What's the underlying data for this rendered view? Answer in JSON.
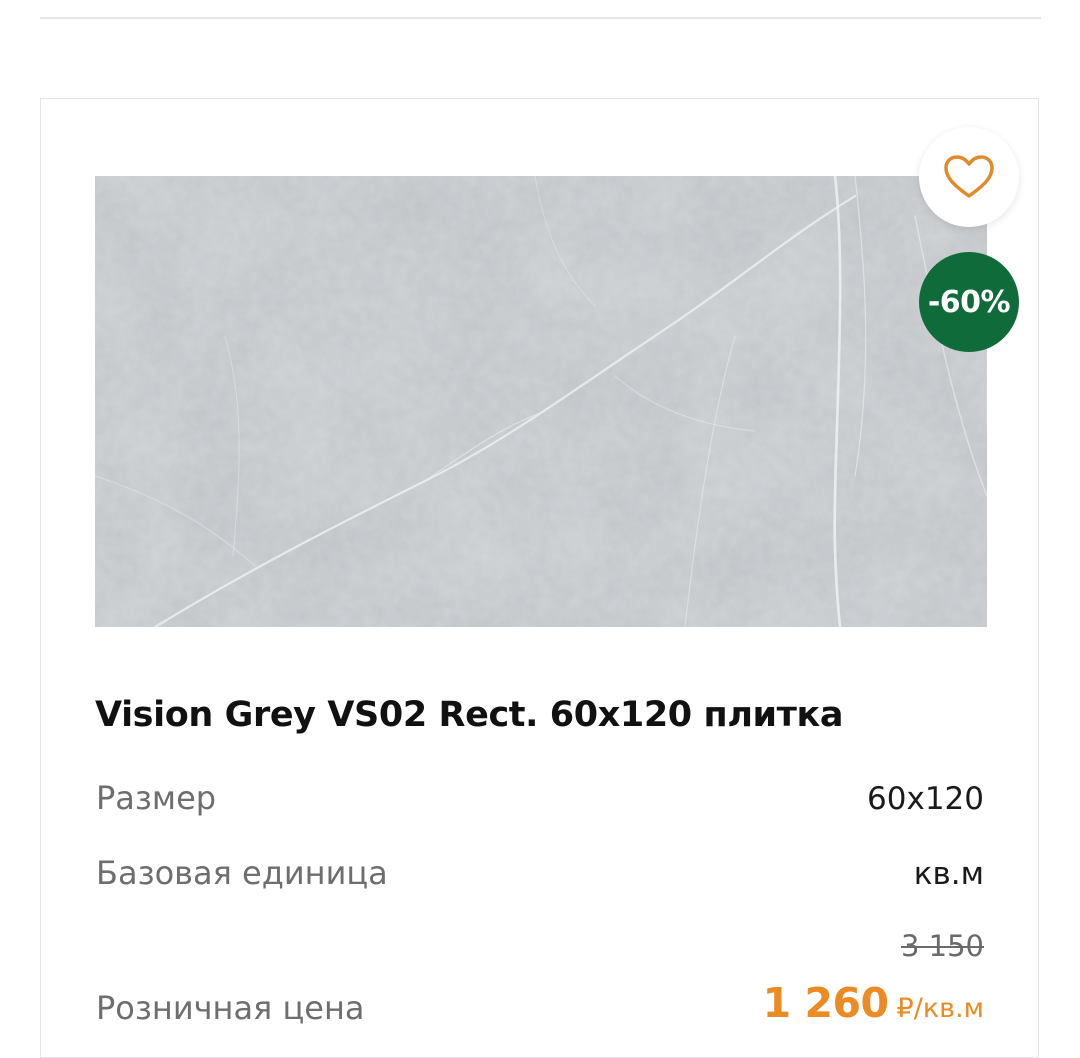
{
  "product": {
    "title": "Vision Grey VS02 Rect. 60x120 плитка",
    "image_alt": "Vision Grey VS02 marble-look tile",
    "discount_label": "-60%",
    "favorite_icon": "heart-icon",
    "specs": [
      {
        "label": "Размер",
        "value": "60x120"
      },
      {
        "label": "Базовая единица",
        "value": "кв.м"
      }
    ],
    "price": {
      "label": "Розничная цена",
      "old": "3 150",
      "current": "1 260",
      "unit": "₽/кв.м"
    }
  },
  "colors": {
    "accent": "#ec8a24",
    "badge": "#0f6b3a",
    "text": "#111111",
    "muted": "#6e6e6e"
  }
}
